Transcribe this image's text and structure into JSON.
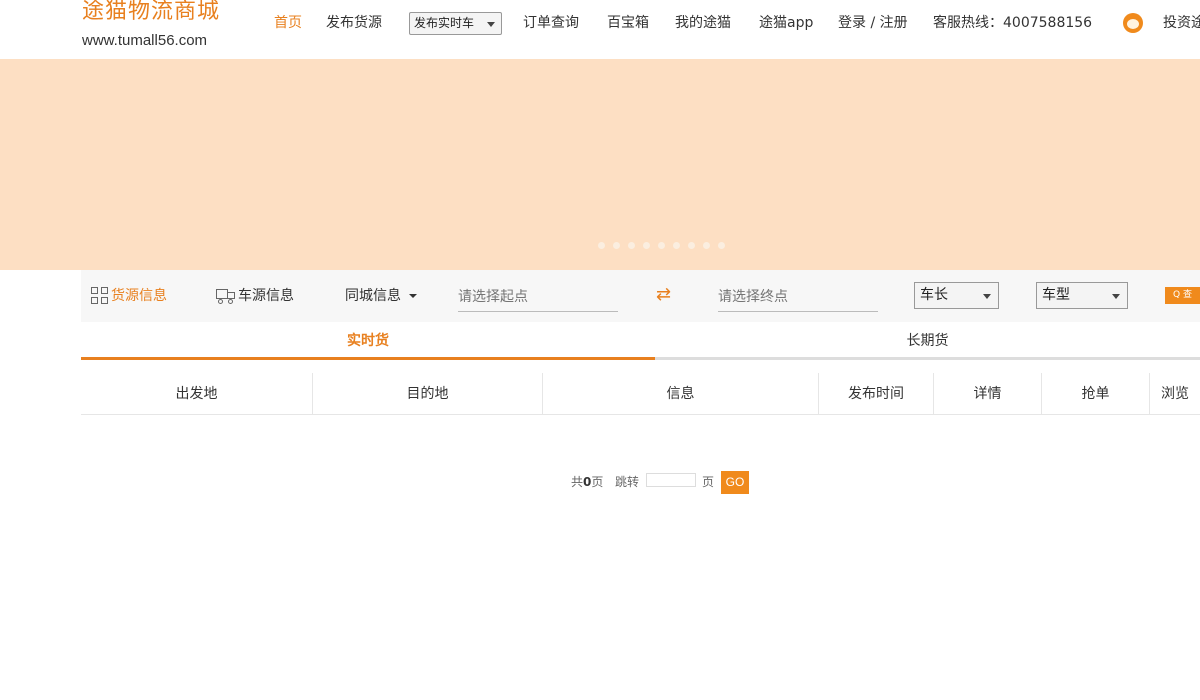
{
  "logo": {
    "title": "途猫物流商城",
    "url": "www.tumall56.com"
  },
  "nav": {
    "home": "首页",
    "publish_cargo": "发布货源",
    "publish_truck_select": "发布实时车",
    "order_query": "订单查询",
    "toolbox": "百宝箱",
    "my_tumao": "我的途猫",
    "app": "途猫app",
    "login": "登录 / 注册",
    "hotline": "客服热线：4007588156",
    "invest": "投资途"
  },
  "colors": {
    "accent": "#e8801f",
    "banner": "#fddfc3"
  },
  "banner": {
    "dot_count": 9
  },
  "search": {
    "cargo_tab": "货源信息",
    "truck_tab": "车源信息",
    "city_tab": "同城信息",
    "start_placeholder": "请选择起点",
    "end_placeholder": "请选择终点",
    "length_select": "车长",
    "type_select": "车型",
    "search_button": "Q 查"
  },
  "tabs": {
    "live": "实时货",
    "long_term": "长期货"
  },
  "table": {
    "columns": [
      "出发地",
      "目的地",
      "信息",
      "发布时间",
      "详情",
      "抢单",
      "浏览"
    ]
  },
  "pager": {
    "total_prefix": "共",
    "total_pages": "0",
    "total_suffix": "页",
    "jump": "跳转",
    "page_unit": "页",
    "go": "GO"
  }
}
